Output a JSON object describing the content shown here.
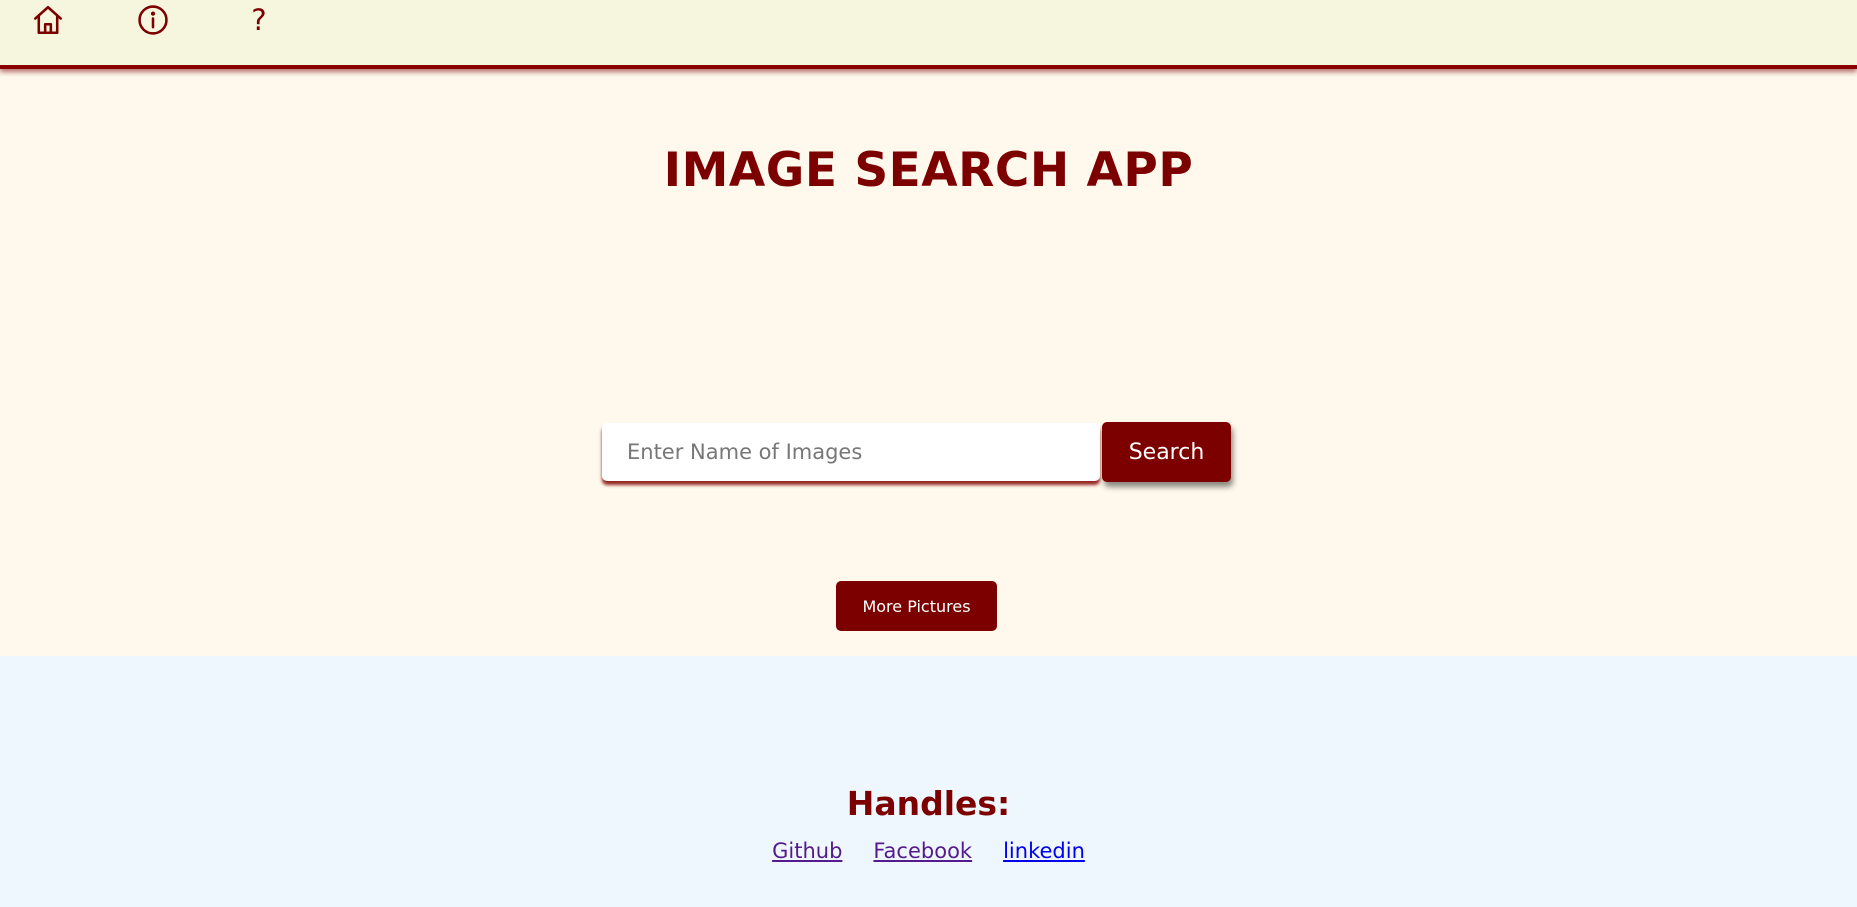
{
  "nav": {
    "icons": [
      "home-icon",
      "info-icon",
      "help-icon"
    ],
    "help_glyph": "?"
  },
  "main": {
    "title": "IMAGE SEARCH APP",
    "search": {
      "value": "",
      "placeholder": "Enter Name of Images",
      "button_label": "Search"
    },
    "more_button_label": "More Pictures"
  },
  "footer": {
    "heading": "Handles:",
    "links": [
      "Github",
      "Facebook",
      "linkedin"
    ]
  },
  "colors": {
    "accent": "#7d0000",
    "header_bg": "#f6f6de",
    "main_bg": "#fef9ec",
    "footer_bg": "#eef7fe",
    "visited_link": "#551a8b",
    "link": "#0000ee"
  }
}
